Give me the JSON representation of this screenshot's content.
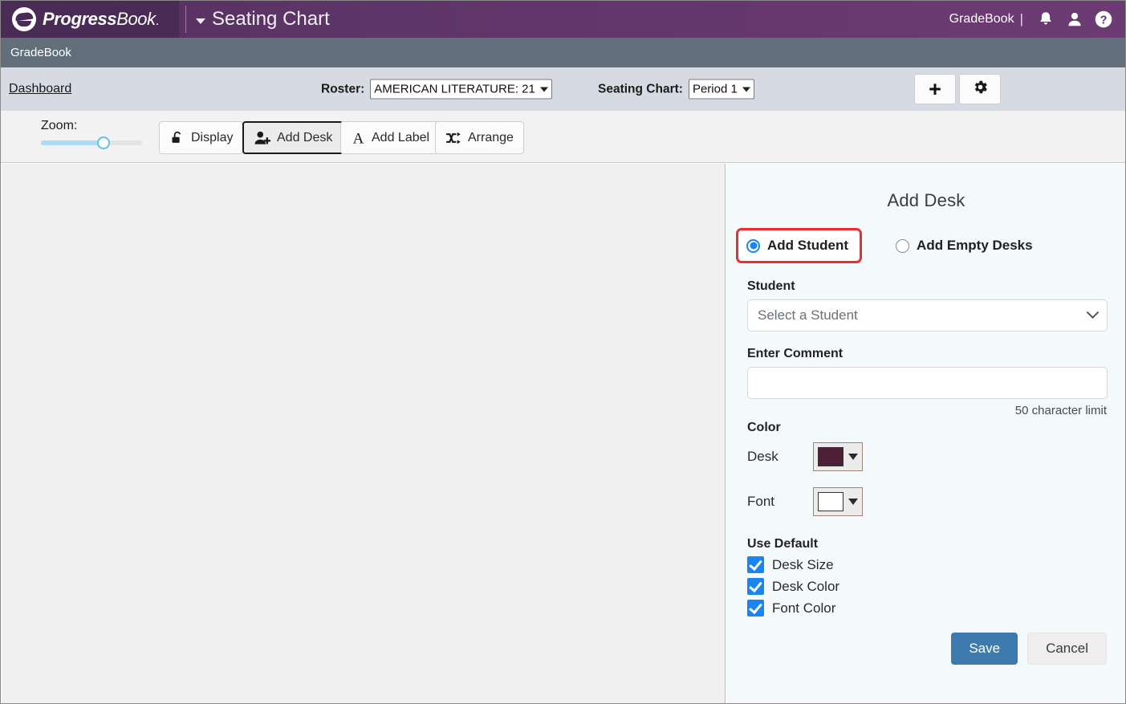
{
  "header": {
    "logo_text_bold": "Progress",
    "logo_text_light": "Book",
    "logo_dot": ".",
    "page_title": "Seating Chart",
    "user_label": "GradeBook",
    "pipe": "|",
    "icons": [
      "bell-icon",
      "user-icon",
      "help-icon"
    ]
  },
  "subheader": {
    "app_name": "GradeBook"
  },
  "controlbar": {
    "breadcrumb": "Dashboard",
    "roster_label": "Roster:",
    "roster_value": "AMERICAN LITERATURE: 21",
    "seating_chart_label": "Seating Chart:",
    "seating_chart_value": "Period 1",
    "add_button_glyph": "+",
    "settings_button": "gear-icon"
  },
  "toolbar": {
    "zoom_label": "Zoom:",
    "zoom_value": 62,
    "buttons": [
      {
        "label": "Display",
        "icon": "unlock-icon",
        "active": false
      },
      {
        "label": "Add Desk",
        "icon": "add-person-icon",
        "active": true
      },
      {
        "label": "Add Label",
        "icon": "text-a-icon",
        "active": false
      },
      {
        "label": "Arrange",
        "icon": "shuffle-icon",
        "active": false
      }
    ]
  },
  "panel": {
    "title": "Add Desk",
    "mode_options": [
      {
        "label": "Add Student",
        "selected": true,
        "highlighted": true
      },
      {
        "label": "Add Empty Desks",
        "selected": false,
        "highlighted": false
      }
    ],
    "student": {
      "label": "Student",
      "value": "Select a Student"
    },
    "comment": {
      "label": "Enter Comment",
      "value": "",
      "hint": "50 character limit"
    },
    "color": {
      "section_label": "Color",
      "desk_label": "Desk",
      "desk_color": "#4e2038",
      "font_label": "Font",
      "font_color": "#ffffff"
    },
    "use_default": {
      "section_label": "Use Default",
      "items": [
        {
          "label": "Desk Size",
          "checked": true
        },
        {
          "label": "Desk Color",
          "checked": true
        },
        {
          "label": "Font Color",
          "checked": true
        }
      ]
    },
    "actions": {
      "save": "Save",
      "cancel": "Cancel"
    }
  },
  "colors": {
    "header_purple": "#5e3568",
    "subheader_gray": "#626f7a",
    "controlbar_gray": "#d6dbe3",
    "accent_blue": "#1a84f0",
    "save_blue": "#3d7aad",
    "highlight_red": "#ed2e2e",
    "canvas_gray": "#f0f0f0",
    "panel_bg": "#f4f9fc"
  }
}
